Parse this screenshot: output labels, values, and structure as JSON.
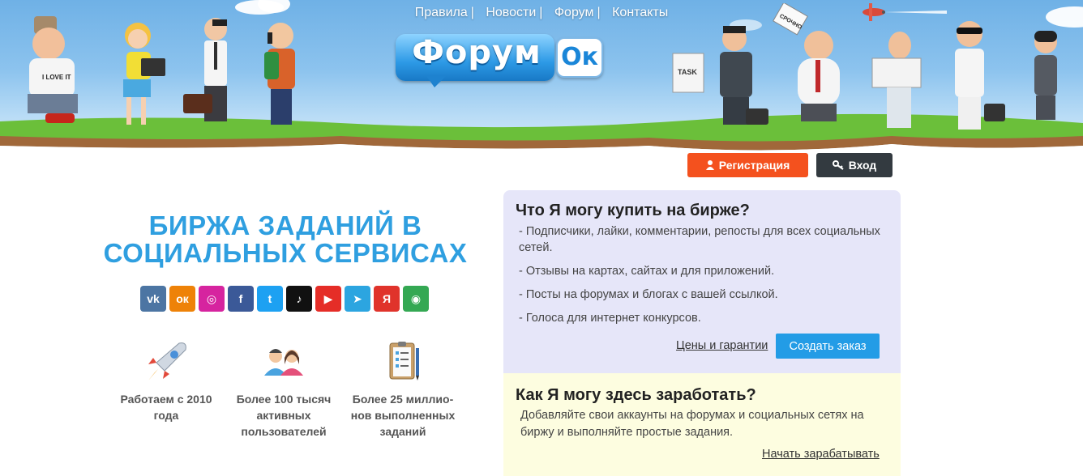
{
  "nav": {
    "items": [
      "Правила",
      "Новости",
      "Форум",
      "Контакты"
    ],
    "separator": "|"
  },
  "logo": {
    "main": "Форум",
    "badge": "Ок"
  },
  "banner_labels": {
    "shirt": "I LOVE IT",
    "task_paper": "TASK",
    "sign": "СРОЧНО"
  },
  "auth": {
    "register": "Регистрация",
    "login": "Вход"
  },
  "hero": {
    "title_line1": "БИРЖА ЗАДАНИЙ В",
    "title_line2": "СОЦИАЛЬНЫХ СЕРВИСАХ"
  },
  "socials": [
    {
      "name": "vk-icon",
      "glyph": "vk",
      "color": "#4c75a3"
    },
    {
      "name": "odnoklassniki-icon",
      "glyph": "ок",
      "color": "#ee8208"
    },
    {
      "name": "instagram-icon",
      "glyph": "◎",
      "color": "#d6249f"
    },
    {
      "name": "facebook-icon",
      "glyph": "f",
      "color": "#3b5998"
    },
    {
      "name": "twitter-icon",
      "glyph": "t",
      "color": "#1da1f2"
    },
    {
      "name": "tiktok-icon",
      "glyph": "♪",
      "color": "#111111"
    },
    {
      "name": "youtube-icon",
      "glyph": "▶",
      "color": "#e52d27"
    },
    {
      "name": "telegram-icon",
      "glyph": "➤",
      "color": "#2ca5e0"
    },
    {
      "name": "yandex-icon",
      "glyph": "Я",
      "color": "#e0332b"
    },
    {
      "name": "google-maps-icon",
      "glyph": "◉",
      "color": "#34a853"
    }
  ],
  "stats": [
    {
      "icon": "rocket-icon",
      "text_lines": [
        "Работаем с 2010",
        "года"
      ]
    },
    {
      "icon": "users-icon",
      "text_lines": [
        "Более 100 тысяч",
        "активных",
        "пользователей"
      ]
    },
    {
      "icon": "clipboard-icon",
      "text_lines": [
        "Более 25 миллио-",
        "нов выполненных",
        "заданий"
      ]
    }
  ],
  "buy_panel": {
    "title": "Что Я могу купить на бирже?",
    "items": [
      "- Подписчики, лайки, комментарии, репосты для всех социальных сетей.",
      "- Отзывы на картах, сайтах и для приложений.",
      "- Посты на форумах и блогах с вашей ссылкой.",
      "- Голоса для интернет конкурсов."
    ],
    "prices_link": "Цены и гарантии",
    "order_button": "Создать заказ"
  },
  "earn_panel": {
    "title": "Как Я могу здесь заработать?",
    "text": "Добавляйте свои аккаунты на форумах и социальных сетях на биржу и выполняйте простые задания.",
    "link": "Начать зарабатывать"
  },
  "colors": {
    "accent_blue": "#2f9fe0",
    "register_orange": "#f4511e",
    "login_dark": "#333a40",
    "buy_panel_bg": "#e6e6f9",
    "earn_panel_bg": "#fdfde0"
  }
}
